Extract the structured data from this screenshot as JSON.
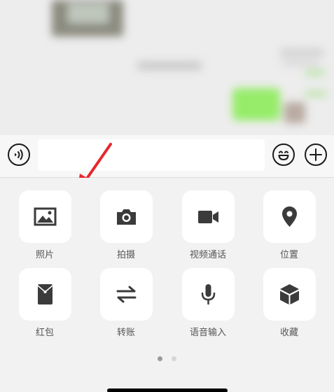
{
  "input_bar": {
    "voice_icon": "voice-wave-icon",
    "emoji_icon": "emoji-smile-icon",
    "plus_icon": "plus-icon",
    "input_value": ""
  },
  "panel": {
    "items": [
      {
        "label": "照片",
        "icon": "photo-icon"
      },
      {
        "label": "拍摄",
        "icon": "camera-icon"
      },
      {
        "label": "视频通话",
        "icon": "video-call-icon"
      },
      {
        "label": "位置",
        "icon": "location-pin-icon"
      },
      {
        "label": "红包",
        "icon": "red-packet-icon"
      },
      {
        "label": "转账",
        "icon": "transfer-arrows-icon"
      },
      {
        "label": "语音输入",
        "icon": "microphone-icon"
      },
      {
        "label": "收藏",
        "icon": "favorites-box-icon"
      }
    ],
    "page_indicator": {
      "current": 1,
      "total": 2
    }
  },
  "colors": {
    "annotation_arrow": "#e8272d",
    "icon": "#3b3b3b",
    "dot_active": "#9a9a9a",
    "dot_inactive": "#d6d6d6"
  }
}
